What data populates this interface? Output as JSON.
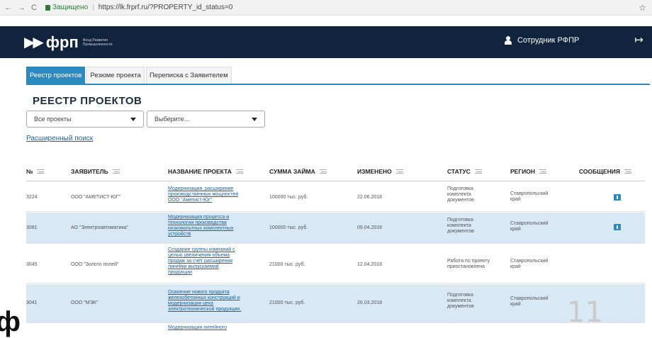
{
  "browser": {
    "back": "←",
    "forward": "→",
    "reload": "C",
    "secure_label": "Защищено",
    "url": "https://lk.frprf.ru/?PROPERTY_id_status=0",
    "star": "☆"
  },
  "header": {
    "logo_mark": "▶▶",
    "logo_text": "фрп",
    "logo_sub_1": "Фонд Развития",
    "logo_sub_2": "Промышленности",
    "user_name": "Сотрудник РФПР",
    "logout": "↦"
  },
  "tabs": [
    {
      "label": "Реестр проектов",
      "active": true
    },
    {
      "label": "Резюме проекта",
      "active": false
    },
    {
      "label": "Переписка с Заявителем",
      "active": false
    }
  ],
  "page_title": "РЕЕСТР ПРОЕКТОВ",
  "filters": {
    "projects_value": "Все проекты",
    "second_placeholder": "Выберите..."
  },
  "advanced_search": "Расширенный поиск",
  "columns": [
    "№",
    "ЗАЯВИТЕЛЬ",
    "НАЗВАНИЕ ПРОЕКТА",
    "СУММА ЗАЙМА",
    "ИЗМЕНЕНО",
    "СТАТУС",
    "РЕГИОН",
    "СООБЩЕНИЯ"
  ],
  "rows": [
    {
      "num": "3224",
      "applicant": "ООО \"АМЕТИСТ-ЮГ\"",
      "project": [
        "Модернизация, расширение",
        "производственных мощностей",
        "ООО \"Аметист-Юг\""
      ],
      "amount": "100000 тыс. руб.",
      "changed": "22.06.2018",
      "status": [
        "Подготовка",
        "комплекта",
        "документов"
      ],
      "region": [
        "Ставропольский",
        "край"
      ],
      "has_message": true
    },
    {
      "num": "3081",
      "applicant": "АО \"Электроавтоматика\"",
      "project": [
        "Модернизация процесса и",
        "технологии производства",
        "низковольтных комплектных",
        "устройств"
      ],
      "amount": "100000 тыс. руб.",
      "changed": "09.04.2018",
      "status": [
        "Подготовка",
        "комплекта",
        "документов"
      ],
      "region": [
        "Ставропольский",
        "край"
      ],
      "has_message": true
    },
    {
      "num": "3045",
      "applicant": "ООО \"Золото полей\"",
      "project": [
        "Создание группы компаний с",
        "целью увеличения объема",
        "продаж за счет расширения",
        "линейки выпускаемой",
        "продукции"
      ],
      "amount": "21000 тыс. руб.",
      "changed": "12.04.2018",
      "status": [
        "Работа по проекту",
        "приостановлена"
      ],
      "region": [
        "Ставропольский",
        "край"
      ],
      "has_message": false
    },
    {
      "num": "3041",
      "applicant": "ООО \"МЭК\"",
      "project": [
        "Освоение нового продукта",
        "железобетонных конструкций и",
        "модернизация цеха",
        "электротехнической продукции."
      ],
      "amount": "21000 тыс. руб.",
      "changed": "26.03.2018",
      "status": [
        "Подготовка",
        "комплекта",
        "документов"
      ],
      "region": [
        "Ставропольский",
        "край"
      ],
      "has_message": false
    },
    {
      "num": "",
      "applicant": "",
      "project": [
        "Модернизация литейного"
      ],
      "amount": "",
      "changed": "",
      "status": [],
      "region": [],
      "has_message": false
    }
  ],
  "slide_number": "11",
  "corner_glyph": "ф"
}
